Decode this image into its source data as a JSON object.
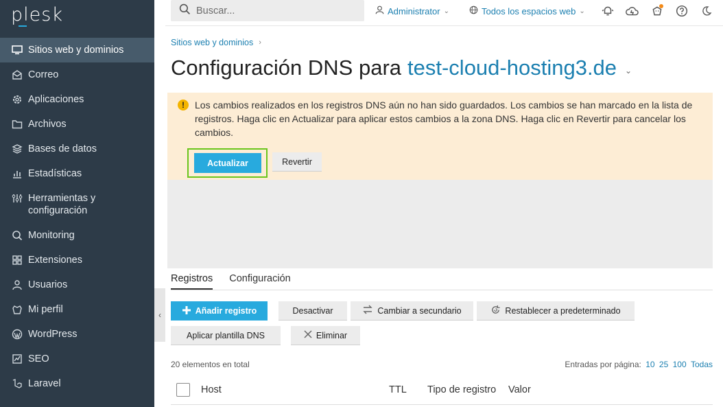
{
  "logo": "plesk",
  "sidebar": {
    "items": [
      {
        "label": "Sitios web y dominios",
        "icon": "monitor-icon"
      },
      {
        "label": "Correo",
        "icon": "mail-icon"
      },
      {
        "label": "Aplicaciones",
        "icon": "gear-icon"
      },
      {
        "label": "Archivos",
        "icon": "folder-icon"
      },
      {
        "label": "Bases de datos",
        "icon": "database-icon"
      },
      {
        "label": "Estadísticas",
        "icon": "bar-chart-icon"
      },
      {
        "label": "Herramientas y configuración",
        "icon": "sliders-icon"
      },
      {
        "label": "Monitoring",
        "icon": "monitoring-icon"
      },
      {
        "label": "Extensiones",
        "icon": "extensions-icon"
      },
      {
        "label": "Usuarios",
        "icon": "user-icon"
      },
      {
        "label": "Mi perfil",
        "icon": "profile-icon"
      },
      {
        "label": "WordPress",
        "icon": "wordpress-icon"
      },
      {
        "label": "SEO",
        "icon": "seo-icon"
      },
      {
        "label": "Laravel",
        "icon": "laravel-icon"
      }
    ]
  },
  "topbar": {
    "search_placeholder": "Buscar...",
    "user": "Administrator",
    "subscriptions": "Todos los espacios web"
  },
  "breadcrumb": "Sitios web y dominios",
  "title": {
    "prefix": "Configuración DNS para",
    "domain": "test-cloud-hosting3.de"
  },
  "warning": {
    "text": "Los cambios realizados en los registros DNS aún no han sido guardados. Los cambios se han marcado en la lista de registros. Haga clic en Actualizar para aplicar estos cambios a la zona DNS. Haga clic en Revertir para cancelar los cambios.",
    "update_label": "Actualizar",
    "revert_label": "Revertir"
  },
  "tabs": [
    "Registros",
    "Configuración"
  ],
  "toolbar": {
    "add": "Añadir registro",
    "deactivate": "Desactivar",
    "secondary": "Cambiar a secundario",
    "reset": "Restablecer a predeterminado",
    "template": "Aplicar plantilla DNS",
    "delete": "Eliminar"
  },
  "list": {
    "total": "20 elementos en total",
    "per_page_label": "Entradas por página:",
    "per_page_options": [
      "10",
      "25",
      "100",
      "Todas"
    ],
    "columns": [
      "Host",
      "TTL",
      "Tipo de registro",
      "Valor"
    ]
  },
  "colors": {
    "sidebar": "#2d3b48",
    "accent": "#28aade",
    "warning_bg": "#fdedd5",
    "highlight": "#6ac51c"
  }
}
